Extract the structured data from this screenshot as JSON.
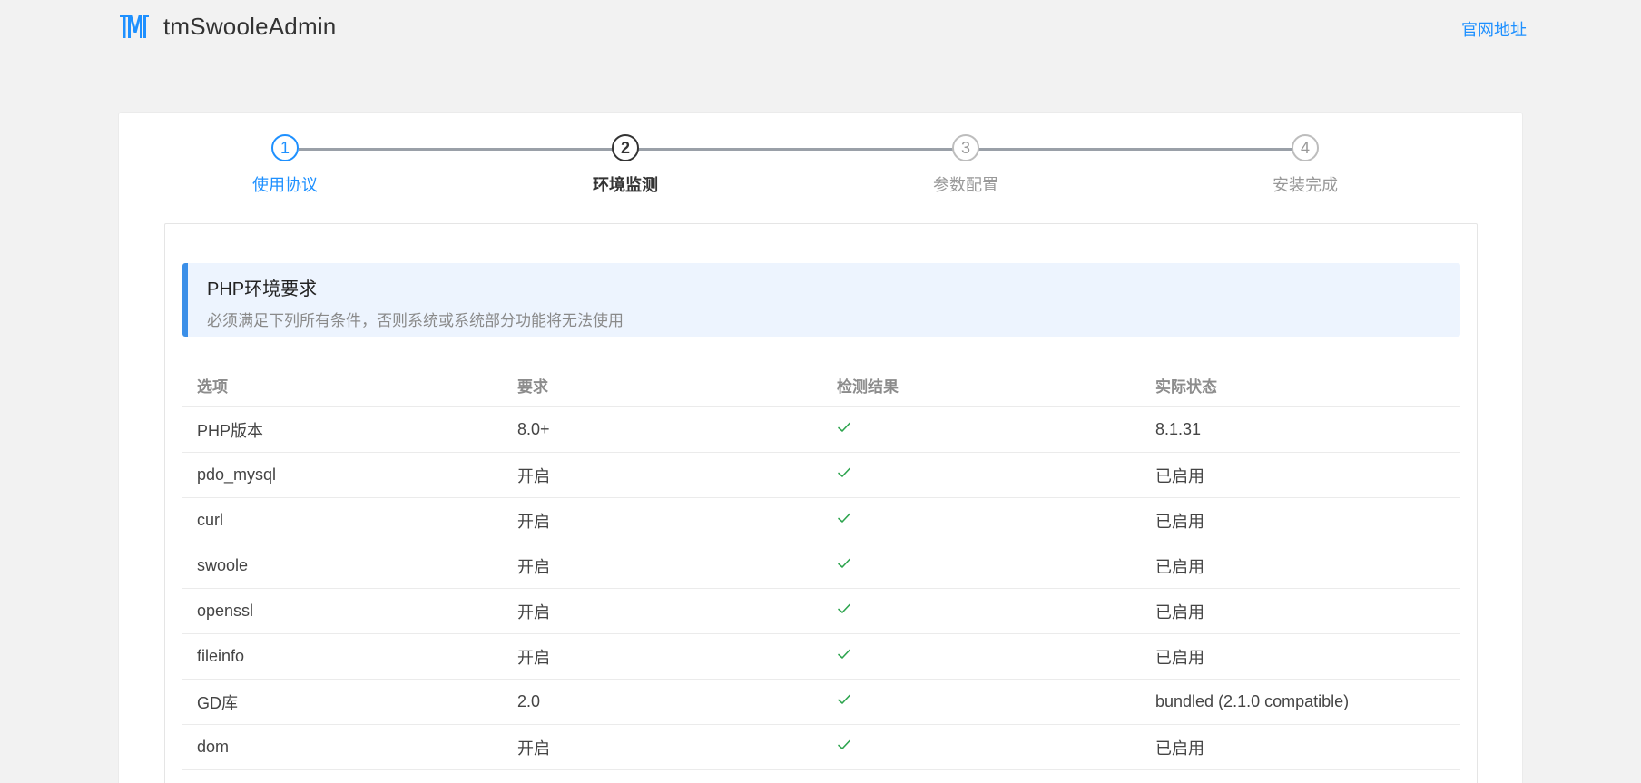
{
  "header": {
    "brand": "tmSwooleAdmin",
    "site_link": "官网地址",
    "logo_icon": "tm-logo-icon",
    "accent_color": "#1e90ff"
  },
  "steps": [
    {
      "number": "1",
      "label": "使用协议",
      "state": "done"
    },
    {
      "number": "2",
      "label": "环境监测",
      "state": "active"
    },
    {
      "number": "3",
      "label": "参数配置",
      "state": "pending"
    },
    {
      "number": "4",
      "label": "安装完成",
      "state": "pending"
    }
  ],
  "notice": {
    "title": "PHP环境要求",
    "description": "必须满足下列所有条件，否则系统或系统部分功能将无法使用"
  },
  "table": {
    "headers": [
      "选项",
      "要求",
      "检测结果",
      "实际状态"
    ],
    "rows": [
      {
        "option": "PHP版本",
        "requirement": "8.0+",
        "result": "check-icon",
        "status": "8.1.31"
      },
      {
        "option": "pdo_mysql",
        "requirement": "开启",
        "result": "check-icon",
        "status": "已启用"
      },
      {
        "option": "curl",
        "requirement": "开启",
        "result": "check-icon",
        "status": "已启用"
      },
      {
        "option": "swoole",
        "requirement": "开启",
        "result": "check-icon",
        "status": "已启用"
      },
      {
        "option": "openssl",
        "requirement": "开启",
        "result": "check-icon",
        "status": "已启用"
      },
      {
        "option": "fileinfo",
        "requirement": "开启",
        "result": "check-icon",
        "status": "已启用"
      },
      {
        "option": "GD库",
        "requirement": "2.0",
        "result": "check-icon",
        "status": "bundled (2.1.0 compatible)"
      },
      {
        "option": "dom",
        "requirement": "开启",
        "result": "check-icon",
        "status": "已启用"
      }
    ],
    "check_color": "#2da44e"
  }
}
